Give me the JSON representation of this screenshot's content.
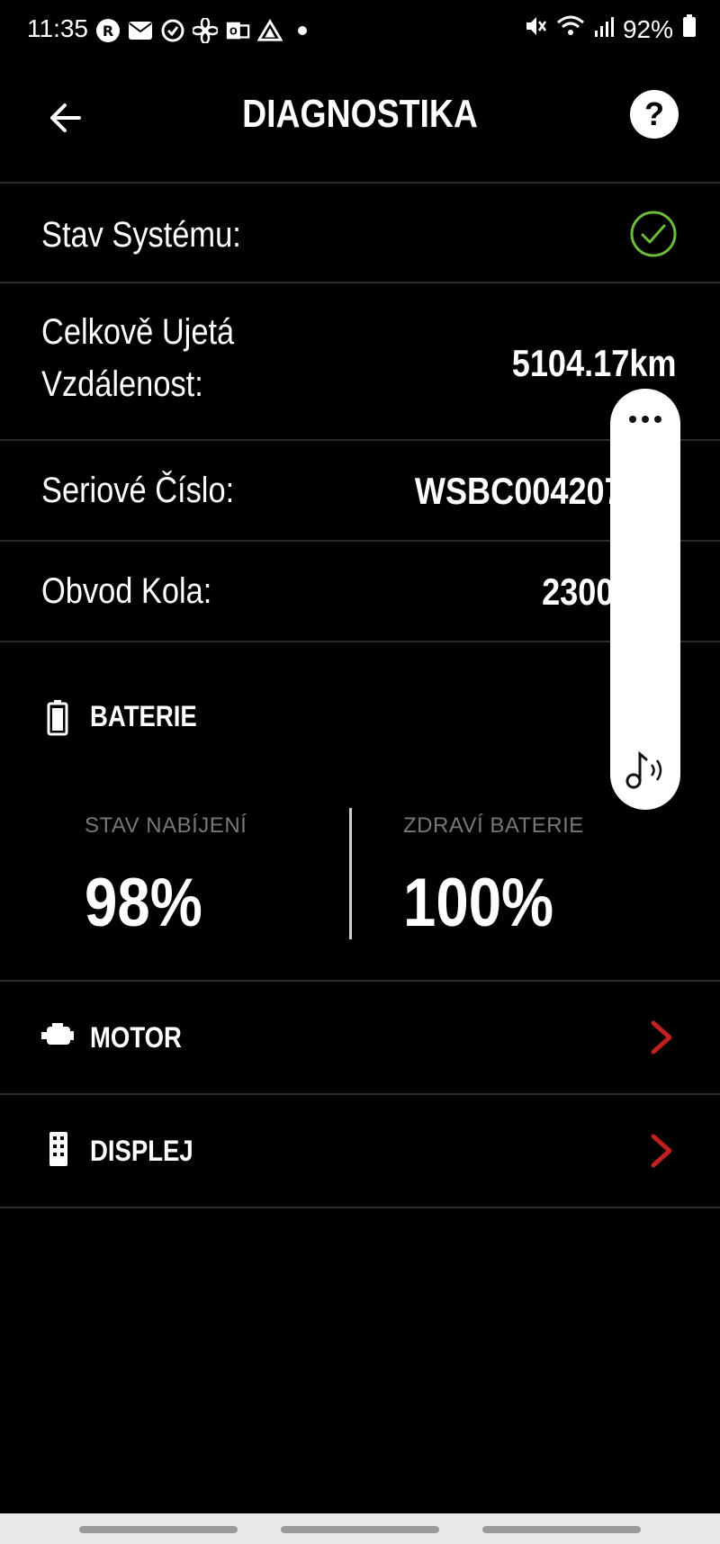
{
  "status_bar": {
    "time": "11:35",
    "battery_percent": "92%",
    "left_icons": [
      "record-icon",
      "mail-icon",
      "sync-icon",
      "fan-icon",
      "outlook-icon",
      "drive-icon",
      "dot-icon"
    ],
    "right_icons": [
      "mute-icon",
      "wifi-icon",
      "signal-icon",
      "battery-icon"
    ]
  },
  "header": {
    "title": "DIAGNOSTIKA",
    "help_label": "?"
  },
  "info_rows": [
    {
      "label": "Stav Systému:",
      "status": "ok"
    },
    {
      "label_line1": "Celkově Ujetá",
      "label_line2": "Vzdálenost:",
      "value": "5104.17km"
    },
    {
      "label": "Seriové Číslo:",
      "value": "WSBC0042072"
    },
    {
      "label": "Obvod Kola:",
      "value": "2300"
    }
  ],
  "battery": {
    "section_title": "BATERIE",
    "charge_label": "STAV NABÍJENÍ",
    "charge_value": "98%",
    "health_label": "ZDRAVÍ BATERIE",
    "health_value": "100%"
  },
  "nav_items": [
    {
      "label": "MOTOR",
      "icon": "engine-icon"
    },
    {
      "label": "DISPLEJ",
      "icon": "display-icon"
    }
  ],
  "colors": {
    "background": "#000000",
    "ok_green": "#6dbb3a",
    "chevron_red": "#c0201e",
    "divider": "#2b2b2b"
  }
}
